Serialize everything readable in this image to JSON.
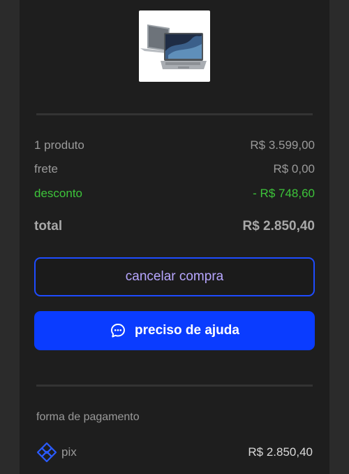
{
  "summary": {
    "products_label": "1 produto",
    "products_value": "R$ 3.599,00",
    "shipping_label": "frete",
    "shipping_value": "R$ 0,00",
    "discount_label": "desconto",
    "discount_value": "- R$ 748,60",
    "total_label": "total",
    "total_value": "R$ 2.850,40"
  },
  "buttons": {
    "cancel_label": "cancelar compra",
    "help_label": "preciso de ajuda"
  },
  "payment": {
    "section_label": "forma de pagamento",
    "method_label": "pix",
    "method_amount": "R$ 2.850,40"
  },
  "colors": {
    "accent": "#0a3cff",
    "discount": "#3dc43a",
    "cancel_text": "#b7a6ff"
  },
  "icons": {
    "help": "chat-bubble-icon",
    "payment": "pix-icon",
    "product": "laptop-image"
  }
}
